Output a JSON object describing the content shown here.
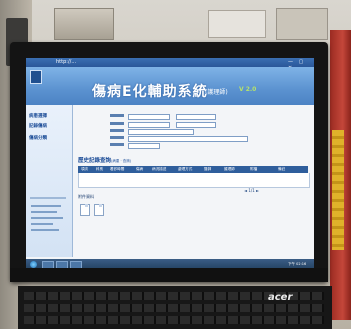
{
  "window": {
    "title": "http://...",
    "controls": "— ▢ ✕"
  },
  "app": {
    "title": "傷病E化輔助系統",
    "subtitle": "(護理師)",
    "version": "V 2.0"
  },
  "sidebar": {
    "items": [
      {
        "label": "病患選擇"
      },
      {
        "label": "記錄傷病"
      },
      {
        "label": "傷病分類"
      }
    ]
  },
  "history": {
    "title": "歷史記錄查詢",
    "hint": "(病患 · 查詢)",
    "columns": [
      "項次",
      "科別",
      "看診時間",
      "傷病",
      "病況描述",
      "處理方式",
      "醫師",
      "護理師",
      "附檔",
      "備註"
    ],
    "tools": "◄ 1/1 ►"
  },
  "attachments": {
    "label": "附件資料"
  },
  "taskbar": {
    "clock": "下午 02:16"
  },
  "monitor": {
    "brand": "acer"
  }
}
